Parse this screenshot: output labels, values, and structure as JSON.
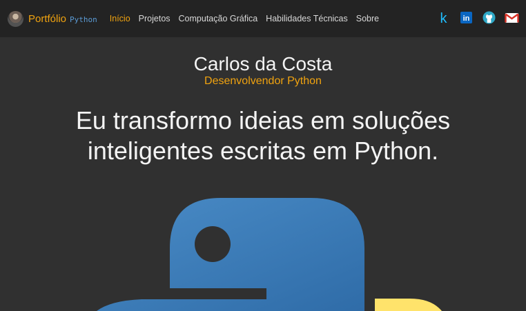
{
  "nav": {
    "brand": "Portfólio",
    "brand_sub": "Python",
    "links": [
      {
        "label": "Início",
        "active": true
      },
      {
        "label": "Projetos",
        "active": false
      },
      {
        "label": "Computação Gráfica",
        "active": false
      },
      {
        "label": "Habilidades Técnicas",
        "active": false
      },
      {
        "label": "Sobre",
        "active": false
      }
    ],
    "socials": [
      {
        "name": "kaggle",
        "letter": "k",
        "color": "#20beff"
      },
      {
        "name": "linkedin",
        "letter": "in",
        "color": "#0a66c2"
      },
      {
        "name": "github",
        "color": "#2ea8c7"
      },
      {
        "name": "gmail",
        "color": "#d93025"
      }
    ]
  },
  "hero": {
    "name": "Carlos da Costa",
    "role": "Desenvolvendor Python",
    "tagline": "Eu transformo ideias em soluções inteligentes escritas em Python."
  },
  "colors": {
    "accent": "#f1a30f",
    "background": "#303030",
    "navbar": "#232323",
    "python_blue": "#3d7dba",
    "python_yellow": "#ffe36b"
  }
}
